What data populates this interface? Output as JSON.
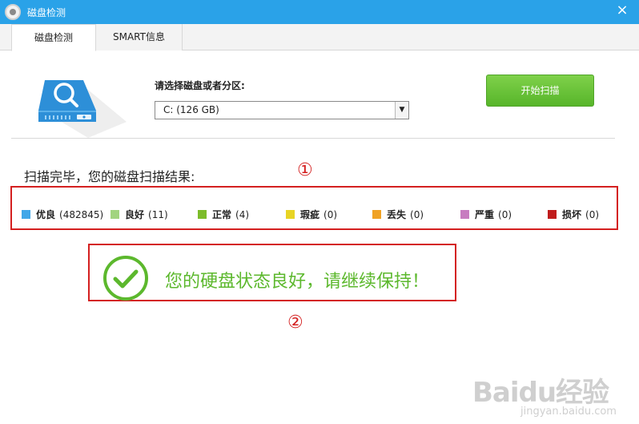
{
  "window": {
    "title": "磁盘检测",
    "close_label": "×"
  },
  "tabs": [
    {
      "label": "磁盘检测",
      "active": true
    },
    {
      "label": "SMART信息",
      "active": false
    }
  ],
  "scan": {
    "select_label": "请选择磁盘或者分区:",
    "selected_option": "C:  (126 GB)",
    "start_button_label": "开始扫描"
  },
  "results": {
    "title": "扫描完毕，您的磁盘扫描结果:",
    "legend": [
      {
        "name": "优良",
        "count": "(482845)",
        "color": "#41a7e8"
      },
      {
        "name": "良好",
        "count": "(11)",
        "color": "#a2d47f"
      },
      {
        "name": "正常",
        "count": "(4)",
        "color": "#7cbc2a"
      },
      {
        "name": "瑕疵",
        "count": "(0)",
        "color": "#e8d424"
      },
      {
        "name": "丢失",
        "count": "(0)",
        "color": "#f0a224"
      },
      {
        "name": "严重",
        "count": "(0)",
        "color": "#c77cc0"
      },
      {
        "name": "损坏",
        "count": "(0)",
        "color": "#c01c1c"
      }
    ],
    "status_message": "您的硬盘状态良好，请继续保持！"
  },
  "annotations": {
    "marker_1": "①",
    "marker_2": "②"
  },
  "watermark": {
    "logo": "Baidu经验",
    "url": "jingyan.baidu.com"
  },
  "colors": {
    "titlebar": "#2aa2e8",
    "accent_green": "#5cb82d",
    "highlight_red": "#d42020"
  }
}
